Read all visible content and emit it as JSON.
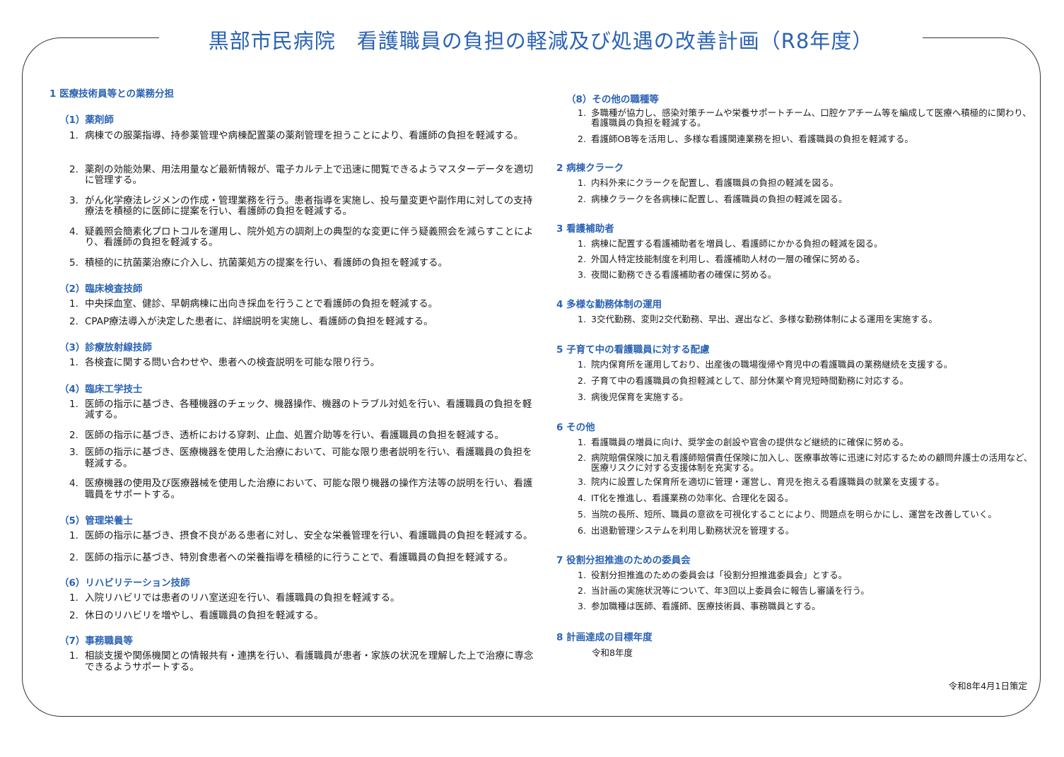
{
  "title": "黒部市民病院　看護職員の負担の軽減及び処遇の改善計画（R8年度）",
  "left": {
    "section1_title": "1 医療技術員等との業務分担",
    "subs": [
      {
        "title": "（1）薬剤師",
        "items": [
          {
            "n": "1.",
            "t": "病棟での服薬指導、持参薬管理や病棟配置薬の薬剤管理を担うことにより、看護師の負担を軽減する。"
          },
          {
            "n": "2.",
            "t": "薬剤の効能効果、用法用量など最新情報が、電子カルテ上で迅速に閲覧できるようマスターデータを適切に管理する。"
          },
          {
            "n": "3.",
            "t": "がん化学療法レジメンの作成・管理業務を行う。患者指導を実施し、投与量変更や副作用に対しての支持療法を積極的に医師に提案を行い、看護師の負担を軽減する。"
          },
          {
            "n": "4.",
            "t": "疑義照会簡素化プロトコルを運用し、院外処方の調剤上の典型的な変更に伴う疑義照会を減らすことにより、看護師の負担を軽減する。"
          },
          {
            "n": "5.",
            "t": "積極的に抗菌薬治療に介入し、抗菌薬処方の提案を行い、看護師の負担を軽減する。"
          }
        ]
      },
      {
        "title": "（2）臨床検査技師",
        "items": [
          {
            "n": "1.",
            "t": "中央採血室、健診、早朝病棟に出向き採血を行うことで看護師の負担を軽減する。"
          },
          {
            "n": "2.",
            "t": "CPAP療法導入が決定した患者に、詳細説明を実施し、看護師の負担を軽減する。"
          }
        ]
      },
      {
        "title": "（3）診療放射線技師",
        "items": [
          {
            "n": "1.",
            "t": "各検査に関する問い合わせや、患者への検査説明を可能な限り行う。"
          }
        ]
      },
      {
        "title": "（4）臨床工学技士",
        "items": [
          {
            "n": "1.",
            "t": "医師の指示に基づき、各種機器のチェック、機器操作、機器のトラブル対処を行い、看護職員の負担を軽減する。"
          },
          {
            "n": "2.",
            "t": "医師の指示に基づき、透析における穿刺、止血、処置介助等を行い、看護職員の負担を軽減する。"
          },
          {
            "n": "3.",
            "t": "医師の指示に基づき、医療機器を使用した治療において、可能な限り患者説明を行い、看護職員の負担を軽減する。"
          },
          {
            "n": "4.",
            "t": "医療機器の使用及び医療器械を使用した治療において、可能な限り機器の操作方法等の説明を行い、看護職員をサポートする。"
          }
        ]
      },
      {
        "title": "（5）管理栄養士",
        "items": [
          {
            "n": "1.",
            "t": "医師の指示に基づき、摂食不良がある患者に対し、安全な栄養管理を行い、看護職員の負担を軽減する。"
          },
          {
            "n": "2.",
            "t": "医師の指示に基づき、特別食患者への栄養指導を積極的に行うことで、看護職員の負担を軽減する。"
          }
        ]
      },
      {
        "title": "（6）リハビリテーション技師",
        "items": [
          {
            "n": "1.",
            "t": "入院リハビリでは患者のリハ室送迎を行い、看護職員の負担を軽減する。"
          },
          {
            "n": "2.",
            "t": "休日のリハビリを増やし、看護職員の負担を軽減する。"
          }
        ]
      },
      {
        "title": "（7）事務職員等",
        "items": [
          {
            "n": "1.",
            "t": "相談支援や関係機関との情報共有・連携を行い、看護職員が患者・家族の状況を理解した上で治療に専念できるようサポートする。"
          }
        ]
      }
    ]
  },
  "right": {
    "sub8": {
      "title": "（8）その他の職種等",
      "items": [
        {
          "n": "1.",
          "t": "多職種が協力し、感染対策チームや栄養サポートチーム、口腔ケアチーム等を編成して医療へ積極的に関わり、看護職員の負担を軽減する。"
        },
        {
          "n": "2.",
          "t": "看護師OB等を活用し、多様な看護関連業務を担い、看護職員の負担を軽減する。"
        }
      ]
    },
    "sections": [
      {
        "title": "2 病棟クラーク",
        "items": [
          {
            "n": "1.",
            "t": "内科外来にクラークを配置し、看護職員の負担の軽減を図る。"
          },
          {
            "n": "2.",
            "t": "病棟クラークを各病棟に配置し、看護職員の負担の軽減を図る。"
          }
        ]
      },
      {
        "title": "3 看護補助者",
        "items": [
          {
            "n": "1.",
            "t": "病棟に配置する看護補助者を増員し、看護師にかかる負担の軽減を図る。"
          },
          {
            "n": "2.",
            "t": "外国人特定技能制度を利用し、看護補助人材の一層の確保に努める。"
          },
          {
            "n": "3.",
            "t": "夜間に勤務できる看護補助者の確保に努める。"
          }
        ]
      },
      {
        "title": "4 多様な勤務体制の運用",
        "items": [
          {
            "n": "1.",
            "t": "3交代勤務、変則2交代勤務、早出、遅出など、多様な勤務体制による運用を実施する。"
          }
        ]
      },
      {
        "title": "5 子育て中の看護職員に対する配慮",
        "items": [
          {
            "n": "1.",
            "t": "院内保育所を運用しており、出産後の職場復帰や育児中の看護職員の業務継続を支援する。"
          },
          {
            "n": "2.",
            "t": "子育て中の看護職員の負担軽減として、部分休業や育児短時間勤務に対応する。"
          },
          {
            "n": "3.",
            "t": "病後児保育を実施する。"
          }
        ]
      },
      {
        "title": "6 その他",
        "items": [
          {
            "n": "1.",
            "t": "看護職員の増員に向け、奨学金の創設や官舎の提供など継続的に確保に努める。"
          },
          {
            "n": "2.",
            "t": "病院賠償保険に加え看護師賠償責任保険に加入し、医療事故等に迅速に対応するための顧問弁護士の活用など、医療リスクに対する支援体制を充実する。"
          },
          {
            "n": "3.",
            "t": "院内に設置した保育所を適切に管理・運営し、育児を抱える看護職員の就業を支援する。"
          },
          {
            "n": "4.",
            "t": "IT化を推進し、看護業務の効率化、合理化を図る。"
          },
          {
            "n": "5.",
            "t": "当院の長所、短所、職員の意欲を可視化することにより、問題点を明らかにし、運営を改善していく。"
          },
          {
            "n": "6.",
            "t": "出退勤管理システムを利用し勤務状況を管理する。"
          }
        ]
      },
      {
        "title": "7 役割分担推進のための委員会",
        "items": [
          {
            "n": "1.",
            "t": "役割分担推進のための委員会は「役割分担推進委員会」とする。"
          },
          {
            "n": "2.",
            "t": "当計画の実施状況等について、年3回以上委員会に報告し審議を行う。"
          },
          {
            "n": "3.",
            "t": "参加職種は医師、看護師、医療技術員、事務職員とする。"
          }
        ]
      }
    ],
    "section8_title": "8 計画達成の目標年度",
    "section8_text": "令和8年度"
  },
  "footer": "令和8年4月1日策定",
  "colors": {
    "accent": "#2b63b4",
    "text": "#1a1a1a"
  }
}
